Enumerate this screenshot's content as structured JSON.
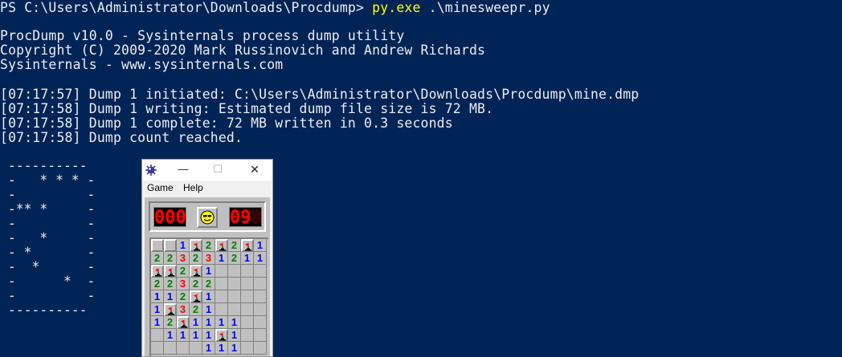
{
  "terminal": {
    "prompt": "PS C:\\Users\\Administrator\\Downloads\\Procdump> ",
    "command": "py.exe",
    "command_args": " .\\minesweepr.py",
    "lines": [
      "ProcDump v10.0 - Sysinternals process dump utility",
      "Copyright (C) 2009-2020 Mark Russinovich and Andrew Richards",
      "Sysinternals - www.sysinternals.com",
      "",
      "[07:17:57] Dump 1 initiated: C:\\Users\\Administrator\\Downloads\\Procdump\\mine.dmp",
      "[07:17:58] Dump 1 writing: Estimated dump file size is 72 MB.",
      "[07:17:58] Dump 1 complete: 72 MB written in 0.3 seconds",
      "[07:17:58] Dump count reached."
    ],
    "ascii_board": [
      " ----------",
      " -   * * * -",
      " -         -",
      " -** *     -",
      " -         -",
      " -   *     -",
      " - *       -",
      " -  *      -",
      " -      *  -",
      " -         -",
      " ----------"
    ]
  },
  "minesweeper": {
    "window_title": "",
    "icon": "mine-icon",
    "controls": {
      "minimize": "—",
      "maximize": "☐",
      "close": "✕"
    },
    "menu": {
      "game": "Game",
      "help": "Help"
    },
    "mines_counter": "000",
    "timer": "09",
    "timer_ghost": "8",
    "face": "smiley-icon",
    "colors": {
      "one": "#0000ff",
      "two": "#008000",
      "three": "#ff0000",
      "lcd": "#ff0000"
    },
    "grid": [
      [
        "C",
        "C",
        "1",
        "F",
        "2",
        "F",
        "2",
        "F",
        "1"
      ],
      [
        "2",
        "2",
        "3",
        "2",
        "3",
        "1",
        "2",
        "1",
        "1"
      ],
      [
        "F",
        "F",
        "2",
        "F",
        "1",
        "",
        "",
        "",
        ""
      ],
      [
        "2",
        "2",
        "3",
        "2",
        "2",
        "",
        "",
        "",
        ""
      ],
      [
        "1",
        "1",
        "2",
        "F",
        "1",
        "",
        "",
        "",
        ""
      ],
      [
        "1",
        "F",
        "3",
        "2",
        "1",
        "",
        "",
        "",
        ""
      ],
      [
        "1",
        "2",
        "F",
        "1",
        "1",
        "1",
        "1",
        "",
        ""
      ],
      [
        "",
        "1",
        "1",
        "1",
        "1",
        "F",
        "1",
        "",
        ""
      ],
      [
        "",
        "",
        "",
        "",
        "1",
        "1",
        "1",
        "",
        ""
      ]
    ]
  }
}
